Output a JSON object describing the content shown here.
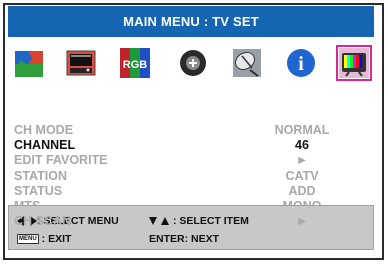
{
  "header": {
    "title": "MAIN MENU : TV SET"
  },
  "icons": [
    {
      "name": "puzzle-icon"
    },
    {
      "name": "tv-screen-icon"
    },
    {
      "name": "rgb-icon",
      "text": "RGB"
    },
    {
      "name": "circle-plus-icon"
    },
    {
      "name": "satellite-dish-icon"
    },
    {
      "name": "info-icon",
      "text": "i"
    },
    {
      "name": "tv-set-icon",
      "selected": true
    }
  ],
  "menu": {
    "items": [
      {
        "label": "CH MODE",
        "value": "NORMAL",
        "active": false
      },
      {
        "label": "CHANNEL",
        "value": "46",
        "active": true
      },
      {
        "label": "EDIT FAVORITE",
        "value": "►",
        "active": false
      },
      {
        "label": "STATION",
        "value": "CATV",
        "active": false
      },
      {
        "label": "STATUS",
        "value": "ADD",
        "active": false
      },
      {
        "label": "MTS",
        "value": "MONO",
        "active": false
      },
      {
        "label": "CH SCAN",
        "value": "►",
        "active": false
      }
    ]
  },
  "help": {
    "select_menu": ": SELECT MENU",
    "exit": ": EXIT",
    "select_item": ": SELECT ITEM",
    "enter_next": "ENTER: NEXT",
    "menu_key": "MENU"
  },
  "colors": {
    "title_bg": "#1565b3",
    "selected_outline": "#d4298f",
    "inactive_text": "#a9a9a9"
  }
}
